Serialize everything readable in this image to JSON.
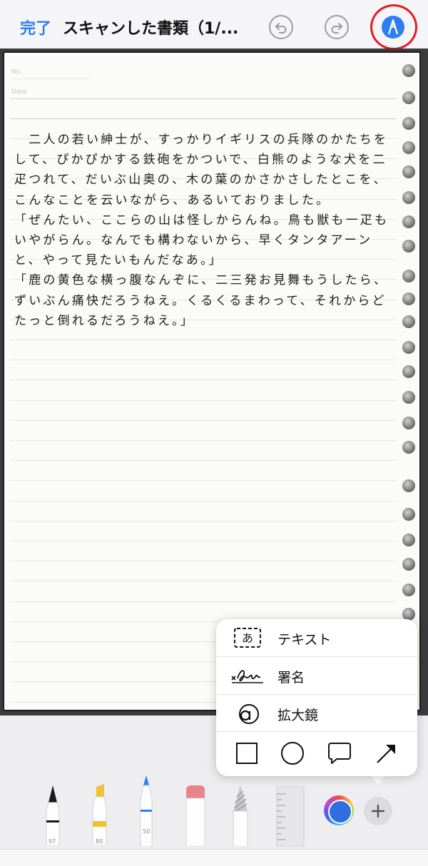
{
  "nav": {
    "done_label": "完了",
    "title": "スキャンした書類（1/..."
  },
  "page": {
    "header_no_label": "No.",
    "header_date_label": "Date",
    "text": "　二人の若い紳士が、すっかりイギリスの兵隊のかたちをして、ぴかぴかする鉄砲をかついで、白熊のような犬を二疋つれて、だいぶ山奥の、木の葉のかさかさしたとこを、こんなことを云いながら、あるいておりました。\n「ぜんたい、ここらの山は怪しからんね。鳥も獣も一疋もいやがらん。なんでも構わないから、早くタンタアーンと、やって見たいもんだなあ。」\n「鹿の黄色な横っ腹なんぞに、二三発お見舞もうしたら、ずいぶん痛快だろうねえ。くるくるまわって、それからどたっと倒れるだろうねえ。」"
  },
  "toolbar": {
    "pen_number": "97",
    "marker_number": "80",
    "pencil_number": "50"
  },
  "menu": {
    "text_icon_glyph": "あ",
    "items": [
      {
        "label": "テキスト",
        "icon": "text-box-icon"
      },
      {
        "label": "署名",
        "icon": "signature-icon"
      },
      {
        "label": "拡大鏡",
        "icon": "magnifier-icon"
      }
    ],
    "shapes": [
      "square-icon",
      "circle-icon",
      "speech-bubble-icon",
      "arrow-icon"
    ]
  },
  "colors": {
    "accent": "#2e7cf6",
    "highlight_ring": "#e51a24",
    "selected_color": "#2f6ee0"
  }
}
